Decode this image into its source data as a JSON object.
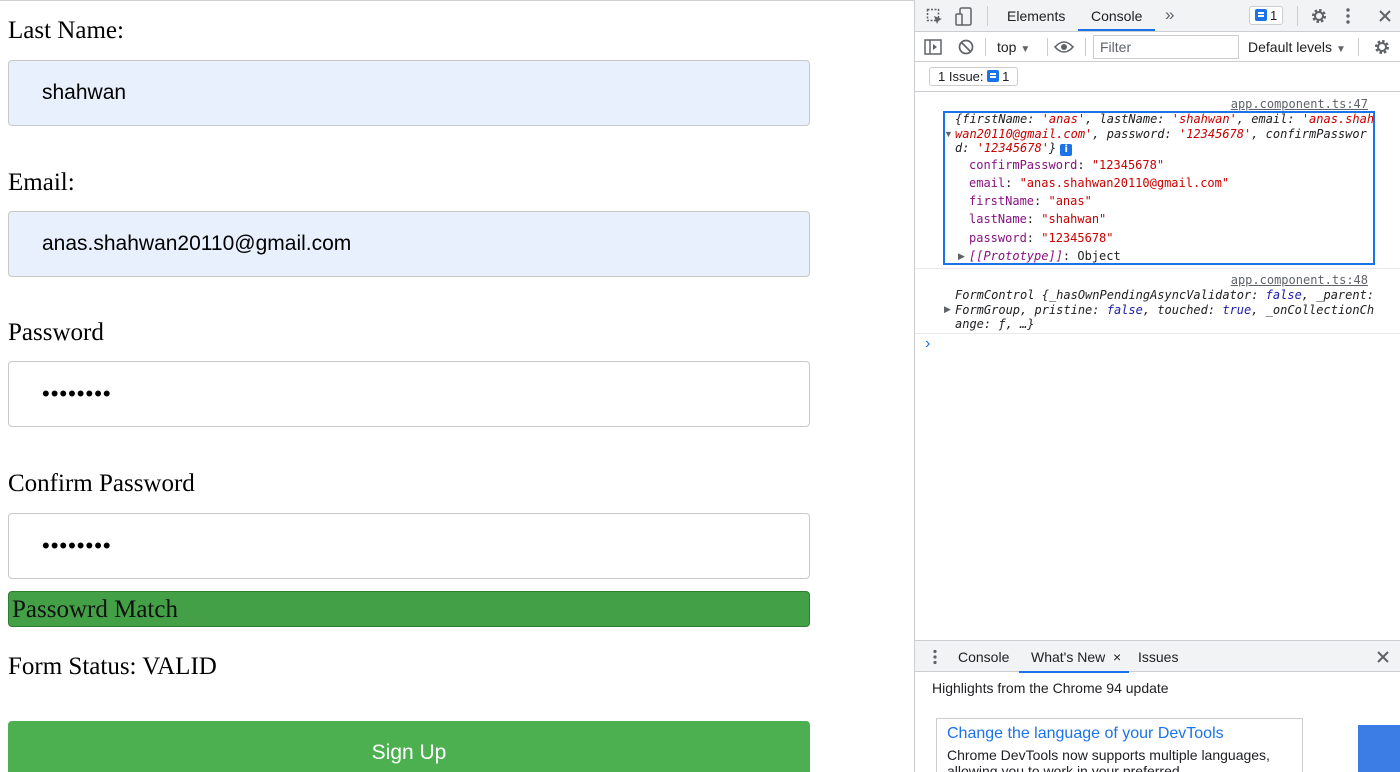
{
  "form": {
    "last_name_label": "Last Name:",
    "last_name_value": "shahwan",
    "email_label": "Email:",
    "email_value": "anas.shahwan20110@gmail.com",
    "password_label": "Password",
    "password_value": "••••••••",
    "confirm_label": "Confirm Password",
    "confirm_value": "••••••••",
    "match_message": "Passowrd Match",
    "status_text": "Form Status: VALID",
    "signup_label": "Sign Up"
  },
  "devtools": {
    "tabs": [
      "Elements",
      "Console"
    ],
    "active_tab": "Console",
    "more_tabs": "»",
    "issues_count": "1",
    "context": "top",
    "filter_placeholder": "Filter",
    "levels": "Default levels",
    "issues_button": "1 Issue:",
    "issues_button_count": "1",
    "accent_color": "#1a73e8",
    "log1": {
      "source": "app.component.ts:47",
      "preview_1": "{firstName: ",
      "preview_2": "'anas'",
      "preview_3": ", lastName: ",
      "preview_4": "'shahwan'",
      "preview_5": ", email: ",
      "preview_6": "'anas.shahwan20110@gmail.com'",
      "preview_7": ", password: ",
      "preview_8": "'12345678'",
      "preview_9": ", confirmPassword: ",
      "preview_10": "'12345678'",
      "preview_11": "}",
      "properties": [
        {
          "key": "confirmPassword",
          "value": "\"12345678\""
        },
        {
          "key": "email",
          "value": "\"anas.shahwan20110@gmail.com\""
        },
        {
          "key": "firstName",
          "value": "\"anas\""
        },
        {
          "key": "lastName",
          "value": "\"shahwan\""
        },
        {
          "key": "password",
          "value": "\"12345678\""
        }
      ],
      "prototype_key": "[[Prototype]]",
      "prototype_value": "Object"
    },
    "log2": {
      "source": "app.component.ts:48",
      "text_1": "FormControl ",
      "text_2": "{_hasOwnPendingAsyncValidator: ",
      "text_3": "false",
      "text_4": ", _parent: ",
      "text_5": "FormGroup",
      "text_6": ", pristine: ",
      "text_7": "false",
      "text_8": ", touched: ",
      "text_9": "true",
      "text_10": ", _onCollectionChange: ",
      "text_11": "ƒ",
      "text_12": ", …}"
    },
    "prompt": "›",
    "drawer": {
      "tabs": [
        "Console",
        "What's New",
        "Issues"
      ],
      "active_tab": "What's New",
      "highlights": "Highlights from the Chrome 94 update",
      "card_title": "Change the language of your DevTools",
      "card_body": "Chrome DevTools now supports multiple languages, allowing you to work in your preferred"
    }
  }
}
